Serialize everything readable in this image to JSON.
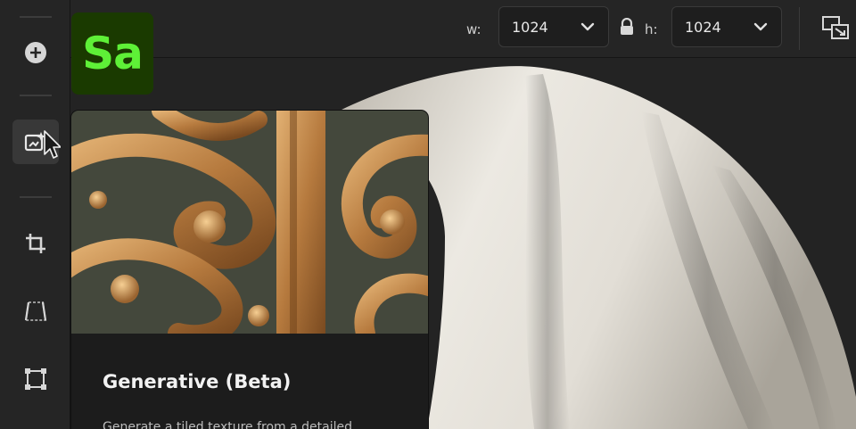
{
  "app": {
    "logo_text": "Sa",
    "logo_color": "#5ef037"
  },
  "sidebar": {
    "tools": [
      {
        "icon": "add-circle-icon"
      },
      {
        "icon": "image-generate-icon",
        "active": true
      },
      {
        "icon": "crop-icon"
      },
      {
        "icon": "perspective-icon"
      },
      {
        "icon": "transform-icon"
      }
    ]
  },
  "toolbar": {
    "width_label": "w:",
    "width_value": "1024",
    "height_label": "h:",
    "height_value": "1024",
    "lock_icon": "lock-icon",
    "fit_icon": "fit-view-icon"
  },
  "card": {
    "title": "Generative (Beta)",
    "description": "Generate a tiled texture from a detailed"
  }
}
